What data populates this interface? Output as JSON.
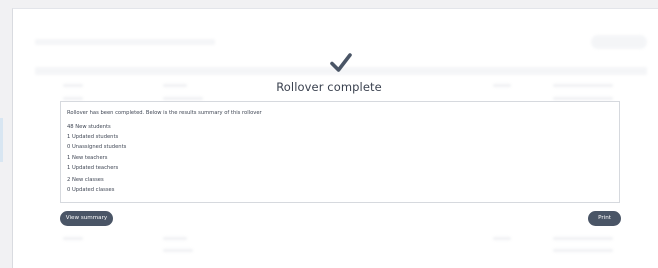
{
  "modal": {
    "title": "Rollover complete",
    "intro": "Rollover has been completed. Below is the results summary of this rollover",
    "students": [
      "48 New students",
      "1 Updated students",
      "0 Unassigned students"
    ],
    "teachers": [
      "1 New teachers",
      "1 Updated teachers"
    ],
    "classes": [
      "2 New classes",
      "0 Updated classes"
    ],
    "view_summary_label": "View summary",
    "print_label": "Print",
    "check_icon": "checkmark-icon",
    "button_color": "#4a5566"
  }
}
